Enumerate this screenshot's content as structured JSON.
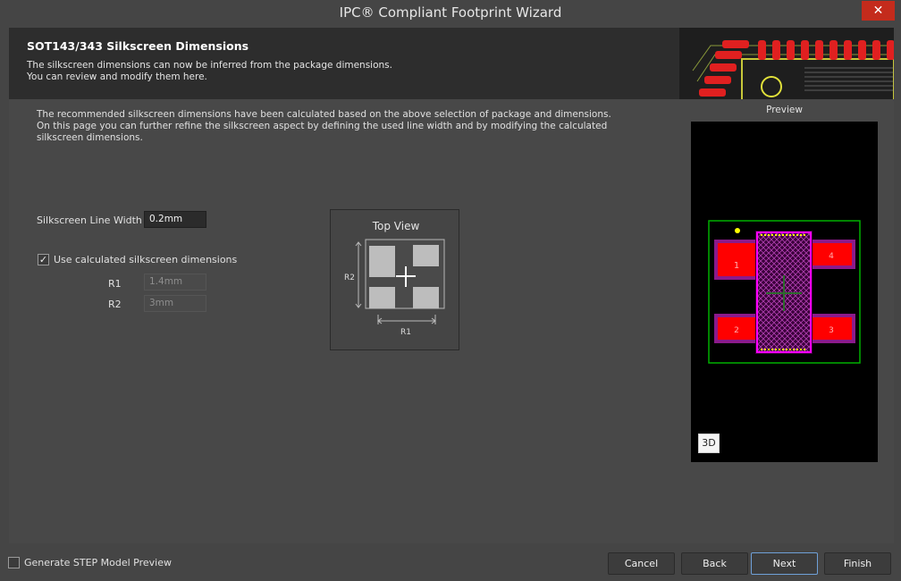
{
  "window": {
    "title": "IPC® Compliant Footprint Wizard",
    "close_glyph": "✕"
  },
  "banner": {
    "title": "SOT143/343 Silkscreen Dimensions",
    "desc_line1": "The silkscreen dimensions can now be inferred from the package dimensions.",
    "desc_line2": "You can review and modify them here."
  },
  "intro": {
    "line1": "The recommended silkscreen dimensions have been calculated based on the above selection of package and dimensions.",
    "line2": "On this page you can further refine the silkscreen aspect by defining the used line width and by modifying the calculated",
    "line3": "silkscreen dimensions."
  },
  "form": {
    "line_width_label": "Silkscreen Line Width",
    "line_width_value": "0.2mm",
    "use_calculated_label": "Use calculated silkscreen dimensions",
    "use_calculated_checked": true,
    "r1_label": "R1",
    "r1_value": "1.4mm",
    "r2_label": "R2",
    "r2_value": "3mm"
  },
  "top_view": {
    "title": "Top View",
    "r1_label": "R1",
    "r2_label": "R2"
  },
  "preview": {
    "label": "Preview",
    "pads": [
      "1",
      "2",
      "3",
      "4"
    ],
    "btn_3d": "3D"
  },
  "footer": {
    "step_label": "Generate STEP Model Preview",
    "step_checked": false,
    "cancel": "Cancel",
    "back": "Back",
    "next": "Next",
    "finish": "Finish"
  },
  "colors": {
    "pad": "#ff0000",
    "pad_outline": "#8b1a8b",
    "courtyard": "#00b000",
    "body_outline": "#ff00ff",
    "dot": "#ffff00",
    "primary_border": "#6fa0d8"
  }
}
